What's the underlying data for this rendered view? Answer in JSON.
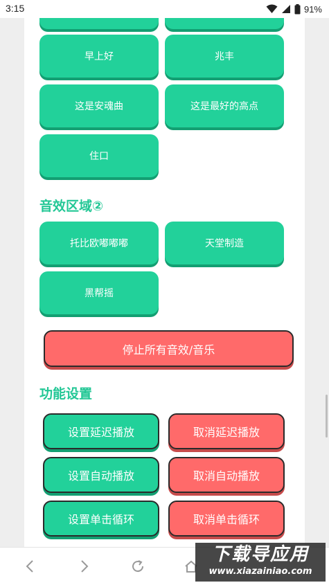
{
  "status_bar": {
    "time": "3:15",
    "battery_text": "91%"
  },
  "sound_section_1": {
    "buttons": [
      {
        "label": ""
      },
      {
        "label": ""
      },
      {
        "label": "早上好"
      },
      {
        "label": "兆丰"
      },
      {
        "label": "这是安魂曲"
      },
      {
        "label": "这是最好的高点"
      },
      {
        "label": "住口"
      }
    ]
  },
  "sound_section_2": {
    "heading": "音效区域②",
    "buttons": [
      {
        "label": "托比欧嘟嘟嘟"
      },
      {
        "label": "天堂制造"
      },
      {
        "label": "黑帮摇"
      }
    ]
  },
  "stop_all": {
    "label": "停止所有音效/音乐"
  },
  "function_settings": {
    "heading": "功能设置",
    "set_delay_label": "设置延迟播放",
    "cancel_delay_label": "取消延迟播放",
    "set_autoplay_label": "设置自动播放",
    "cancel_autoplay_label": "取消自动播放",
    "set_loop_label": "设置单击循环",
    "cancel_loop_label": "取消单击循环"
  },
  "watermark": {
    "title": "下载导应用",
    "url": "www.xiazainiao.com"
  },
  "colors": {
    "green": "#22d19a",
    "red": "#ff6a6a",
    "heading_green": "#22c795"
  },
  "icons": {
    "nav": [
      "back-icon",
      "forward-icon",
      "refresh-icon",
      "home-icon"
    ],
    "status": [
      "wifi-icon",
      "signal-icon",
      "battery-icon"
    ]
  }
}
